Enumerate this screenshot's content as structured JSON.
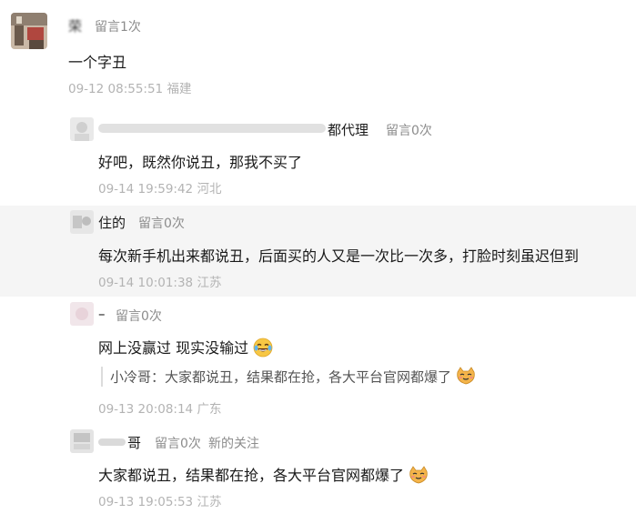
{
  "comments": [
    {
      "name": "荣",
      "badge": "留言1次",
      "text": "一个字丑",
      "time": "09-12 08:55:51",
      "location": "福建"
    },
    {
      "name_visible": "都代理",
      "badge": "留言0次",
      "text": "好吧，既然你说丑，那我不买了",
      "time": "09-14 19:59:42",
      "location": "河北"
    },
    {
      "name_visible": "住的",
      "badge": "留言0次",
      "text": "每次新手机出来都说丑，后面买的人又是一次比一次多，打脸时刻虽迟但到",
      "time": "09-14 10:01:38",
      "location": "江苏"
    },
    {
      "name_visible": "–",
      "badge": "留言0次",
      "text": "网上没赢过 现实没输过",
      "quote": "小冷哥：大家都说丑，结果都在抢，各大平台官网都爆了",
      "time": "09-13 20:08:14",
      "location": "广东"
    },
    {
      "name_visible": "哥",
      "badge": "留言0次",
      "badge2": "新的关注",
      "text": "大家都说丑，结果都在抢，各大平台官网都爆了",
      "time": "09-13 19:05:53",
      "location": "江苏"
    }
  ],
  "icons": {
    "laugh": "tears-of-joy-emoji-icon",
    "cat": "cat-face-emoji-icon"
  }
}
